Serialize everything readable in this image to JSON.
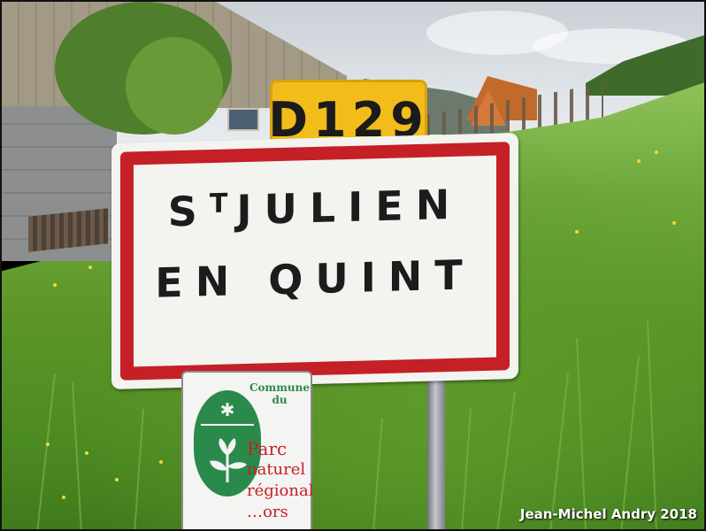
{
  "route_plate": {
    "text": "D129"
  },
  "place_sign": {
    "line1_prefix": "S",
    "line1_sup": "T",
    "line1_rest": "JULIEN",
    "line2": "EN QUINT"
  },
  "parc_panel": {
    "commune_line1": "Commune",
    "commune_line2": "du",
    "word1": "Parc",
    "word2": "naturel",
    "word3": "régional",
    "word4": "…ors"
  },
  "credit": "Jean-Michel Andry 2018",
  "colors": {
    "sign_red": "#c42026",
    "route_yellow": "#f2bc1a",
    "parc_green": "#2a8a4b"
  }
}
